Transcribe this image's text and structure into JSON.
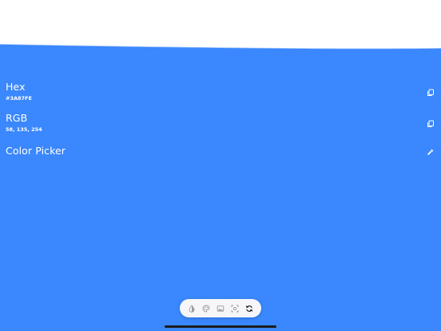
{
  "swatch": {
    "color": "#3A87FE"
  },
  "rows": [
    {
      "title": "Hex",
      "value": "#3A87FE",
      "action_icon": "copy-icon"
    },
    {
      "title": "RGB",
      "value": "58, 135, 254",
      "action_icon": "copy-icon"
    },
    {
      "title": "Color Picker",
      "action_icon": "eyedropper-icon"
    }
  ],
  "toolbar": {
    "tools": [
      {
        "icon": "contrast-icon",
        "active": false
      },
      {
        "icon": "palette-icon",
        "active": false
      },
      {
        "icon": "image-icon",
        "active": false
      },
      {
        "icon": "camera-scan-icon",
        "active": false
      },
      {
        "icon": "refresh-icon",
        "active": true
      }
    ]
  }
}
